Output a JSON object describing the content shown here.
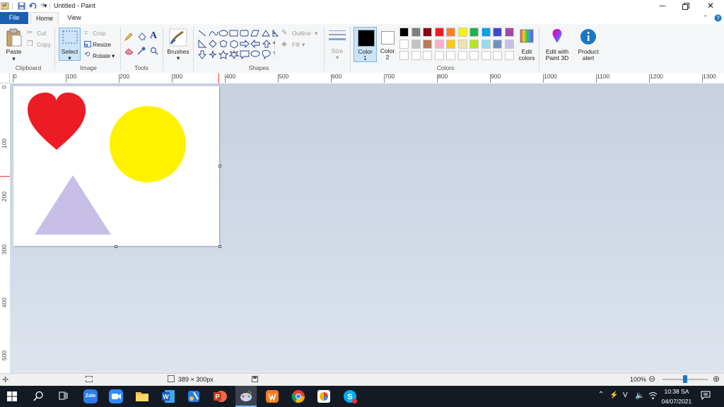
{
  "window": {
    "title": "Untitled - Paint"
  },
  "tabs": {
    "file": "File",
    "home": "Home",
    "view": "View"
  },
  "ribbon": {
    "clipboard": {
      "paste": "Paste",
      "cut": "Cut",
      "copy": "Copy",
      "group": "Clipboard"
    },
    "image": {
      "select": "Select",
      "crop": "Crop",
      "resize": "Resize",
      "rotate": "Rotate",
      "group": "Image"
    },
    "tools": {
      "group": "Tools",
      "text_tool": "A"
    },
    "brushes": "Brushes",
    "shapes": {
      "outline": "Outline",
      "fill": "Fill",
      "group": "Shapes"
    },
    "size": "Size",
    "color1": {
      "label": "Color",
      "num": "1"
    },
    "color2": {
      "label": "Color",
      "num": "2"
    },
    "colors_group": "Colors",
    "edit_colors": {
      "line1": "Edit",
      "line2": "colors"
    },
    "paint3d": {
      "line1": "Edit with",
      "line2": "Paint 3D"
    },
    "product_alert": {
      "line1": "Product",
      "line2": "alert"
    }
  },
  "palette": {
    "row1": [
      "#000000",
      "#7f7f7f",
      "#880015",
      "#ed1c24",
      "#ff7f27",
      "#fff200",
      "#22b14c",
      "#00a2e8",
      "#3f48cc",
      "#a349a4"
    ],
    "row2": [
      "#ffffff",
      "#c3c3c3",
      "#b97a57",
      "#ffaec9",
      "#ffc90e",
      "#efe4b0",
      "#b5e61d",
      "#99d9ea",
      "#7092be",
      "#c8bfe7"
    ]
  },
  "ruler": {
    "h": [
      "0",
      "100",
      "200",
      "300",
      "400",
      "500",
      "600",
      "700",
      "800",
      "900",
      "1000",
      "1100",
      "1200",
      "1300"
    ],
    "v": [
      "0",
      "100",
      "200",
      "300",
      "400",
      "500"
    ]
  },
  "canvas_shapes": {
    "heart_color": "#ed1c24",
    "circle_color": "#fff200",
    "triangle_color": "#c8bfe7"
  },
  "status": {
    "dimensions": "389 × 300px",
    "zoom": "100%",
    "zoom_level": 1.0
  },
  "taskbar": {
    "time": "10:38 SA",
    "date": "04/07/2021",
    "lang": "V"
  }
}
